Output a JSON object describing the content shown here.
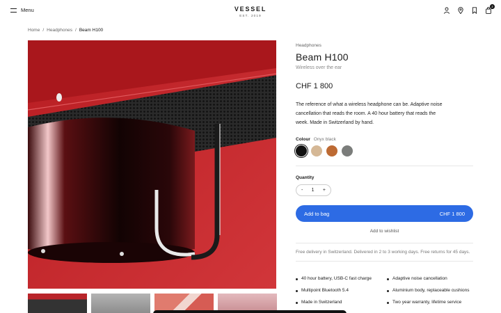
{
  "header": {
    "menu_label": "Menu",
    "logo": "VESSEL",
    "logo_sub": "EST. 2019",
    "cart_count": "2"
  },
  "breadcrumb": [
    "Home",
    "Headphones",
    "Beam H100"
  ],
  "product": {
    "category": "Headphones",
    "name": "Beam H100",
    "subtitle": "Wireless over the ear",
    "price": "CHF 1 800",
    "description": "The reference of what a wireless headphone can be. Adaptive noise cancellation that reads the room. A 40 hour battery that reads the week. Made in Switzerland by hand.",
    "colour_label": "Colour",
    "colour_selected": "Onyx black",
    "swatches": [
      "#111111",
      "#d5b896",
      "#bd6a33",
      "#7b7d7b"
    ],
    "quantity_label": "Quantity",
    "quantity": "1",
    "minus": "-",
    "plus": "+",
    "add_to_bag": "Add to bag",
    "add_to_bag_price": "CHF 1 800",
    "wishlist": "Add to wishlist",
    "delivery": "Free delivery in Switzerland. Delivered in 2 to 3 working days. Free returns for 45 days.",
    "features": [
      "40 hour battery, USB-C fast charge",
      "Adaptive noise cancellation",
      "Multipoint Bluetooth 5.4",
      "Aluminium body, replaceable cushions",
      "Made in Switzerland",
      "Two year warranty, lifetime service"
    ]
  },
  "colors": {
    "accent": "#2d6be4",
    "hero_red": "#c5262b"
  }
}
